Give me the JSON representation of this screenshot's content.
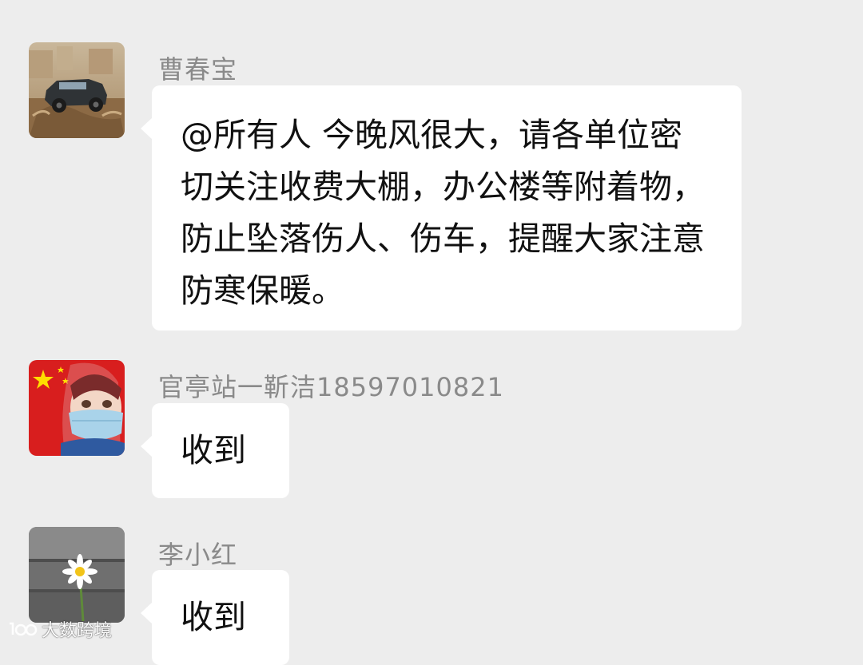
{
  "messages": [
    {
      "sender": "曹春宝",
      "text": "@所有人  今晚风很大，请各单位密切关注收费大棚，办公楼等附着物，防止坠落伤人、伤车，提醒大家注意防寒保暖。",
      "avatar_icon": "offroad-car-avatar"
    },
    {
      "sender": "官亭站一靳洁18597010821",
      "text": "收到",
      "avatar_icon": "flag-masked-girl-avatar"
    },
    {
      "sender": "李小红",
      "text": "收到",
      "avatar_icon": "daisy-flower-avatar"
    }
  ],
  "watermark": {
    "text": "大数跨境",
    "icon": "watermark-logo-icon"
  },
  "colors": {
    "background": "#ededed",
    "bubble": "#ffffff",
    "sender_name": "#8a8a8a",
    "message_text": "#111111"
  }
}
